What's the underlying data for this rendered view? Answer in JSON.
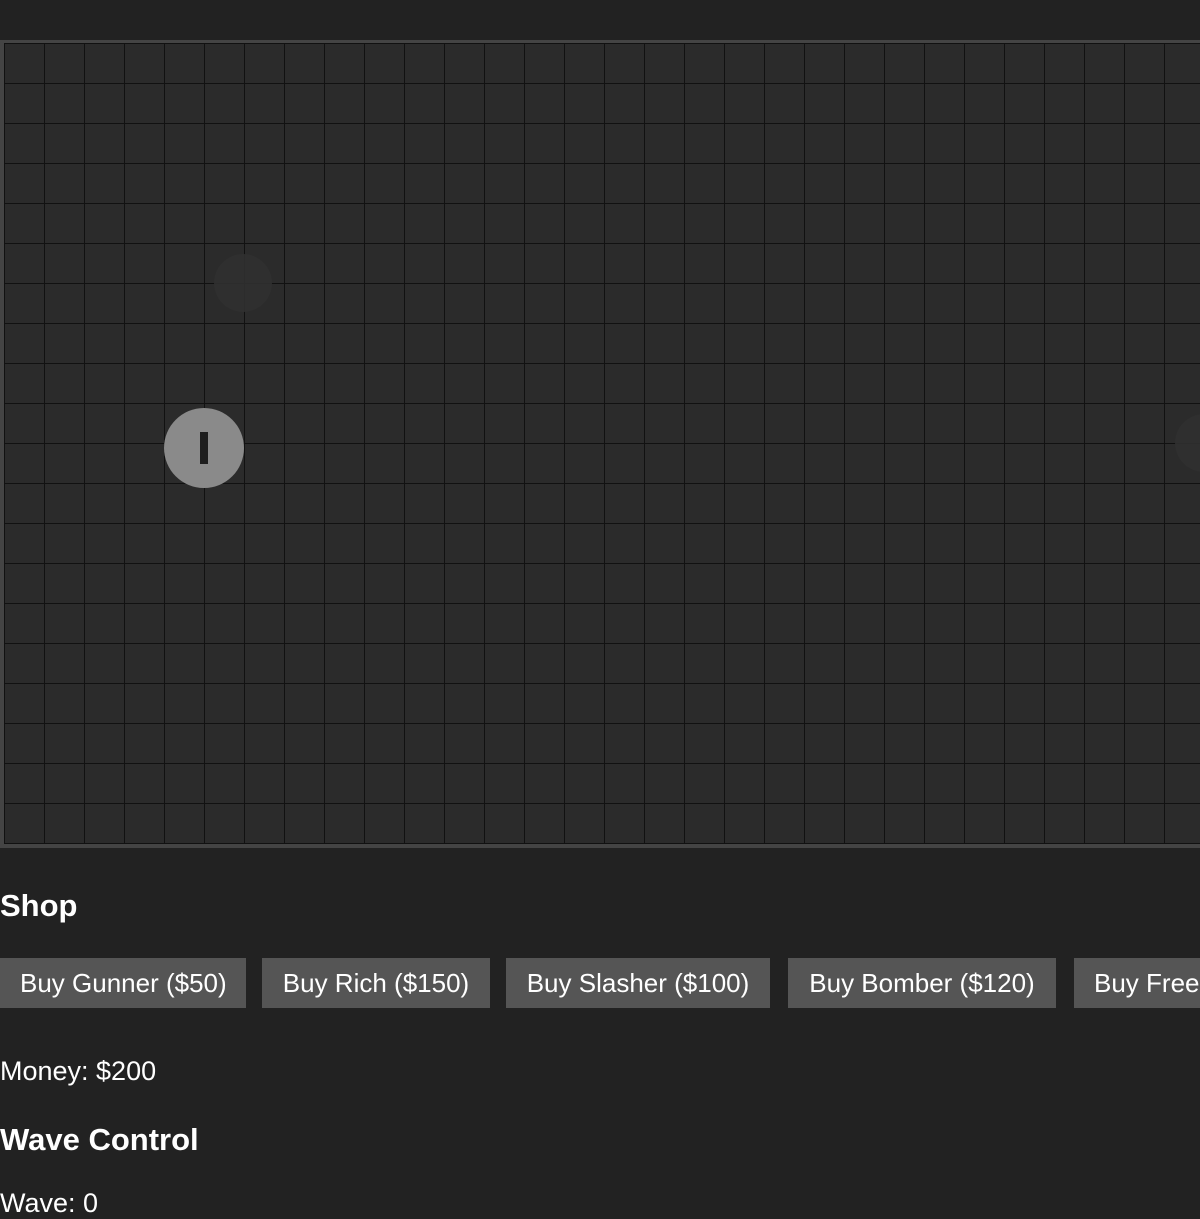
{
  "shop": {
    "heading": "Shop",
    "buttons": [
      {
        "label": "Buy Gunner ($50)"
      },
      {
        "label": "Buy Rich ($150)"
      },
      {
        "label": "Buy Slasher ($100)"
      },
      {
        "label": "Buy Bomber ($120)"
      },
      {
        "label": "Buy Freez"
      }
    ]
  },
  "status": {
    "money_text": "Money: $200"
  },
  "wave_control": {
    "heading": "Wave Control",
    "wave_text": "Wave: 0"
  },
  "colors": {
    "background": "#222222",
    "board": "#2b2b2b",
    "grid_line": "#111111",
    "button": "#555555",
    "unit": "#8a8a8a"
  }
}
